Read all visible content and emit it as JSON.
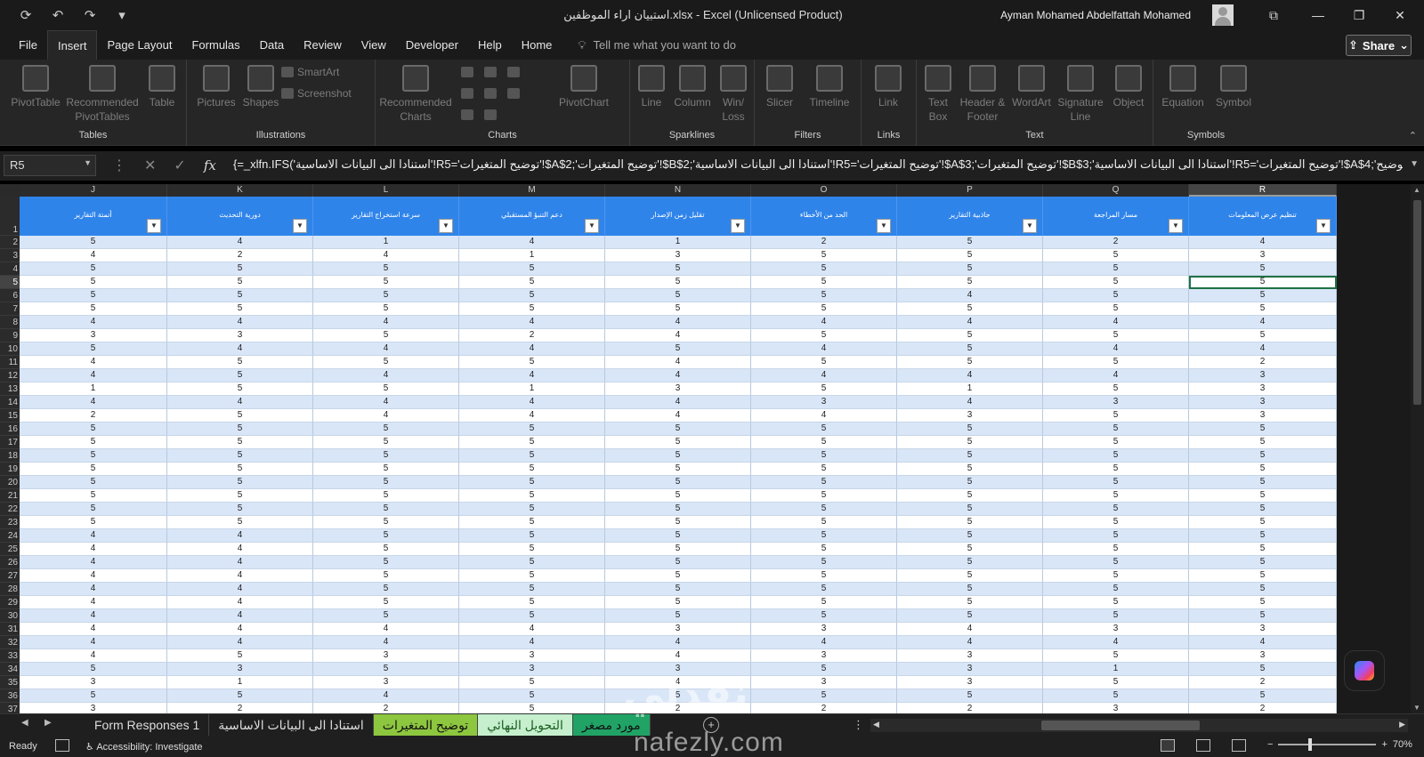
{
  "title_bar": {
    "doc_title": "استبيان اراء الموظفين.xlsx  -  Excel (Unlicensed Product)",
    "user_name": "Ayman Mohamed Abdelfattah Mohamed",
    "icons": [
      "autosave-icon",
      "undo-icon",
      "redo-icon",
      "customize-quick-access-icon",
      "ribbon-display-icon",
      "minimize-icon",
      "maximize-icon",
      "close-icon"
    ]
  },
  "menu": {
    "items": [
      "File",
      "Insert",
      "Page Layout",
      "Formulas",
      "Data",
      "Review",
      "View",
      "Developer",
      "Help",
      "Home"
    ],
    "active": "Insert",
    "tell_me": "Tell me what you want to do",
    "share": "Share"
  },
  "ribbon": {
    "groups": [
      {
        "label": "Tables",
        "buttons": [
          "PivotTable",
          "Recommended PivotTables",
          "Table"
        ]
      },
      {
        "label": "Illustrations",
        "buttons": [
          "Pictures",
          "Shapes"
        ],
        "small": [
          "SmartArt",
          "Screenshot"
        ]
      },
      {
        "label": "Charts",
        "buttons": [
          "Recommended Charts",
          "PivotChart"
        ]
      },
      {
        "label": "Sparklines",
        "buttons": [
          "Line",
          "Column",
          "Win/ Loss"
        ]
      },
      {
        "label": "Filters",
        "buttons": [
          "Slicer",
          "Timeline"
        ]
      },
      {
        "label": "Links",
        "buttons": [
          "Link"
        ]
      },
      {
        "label": "Text",
        "buttons": [
          "Text Box",
          "Header & Footer",
          "WordArt",
          "Signature Line",
          "Object"
        ]
      },
      {
        "label": "Symbols",
        "buttons": [
          "Equation",
          "Symbol"
        ]
      }
    ]
  },
  "formula_bar": {
    "name_box": "R5",
    "formula": "{=_xlfn.IFS('استنادا الى البيانات الاساسية'!R5='توضيح المتغيرات'!$A$2;'توضيح المتغيرات'!$B$2;'استنادا الى البيانات الاساسية'!R5='توضيح المتغيرات'!$A$3;'توضيح المتغيرات'!$B$3;'استنادا الى البيانات الاساسية'!R5='توضيح المتغيرات'!$A$4;'توضيح"
  },
  "sheet": {
    "columns": [
      "J",
      "K",
      "L",
      "M",
      "N",
      "O",
      "P",
      "Q",
      "R"
    ],
    "selected_column": "R",
    "headers": [
      "أتمتة التقارير",
      "دورية التحديث",
      "سرعة استخراج التقارير",
      "دعم التنبؤ المستقبلي",
      "تقليل زمن الإصدار",
      "الحد من الأخطاء",
      "جاذبية التقارير",
      "مسار المراجعة",
      "تنظيم عرض المعلومات"
    ],
    "rows": [
      {
        "n": "2",
        "v": [
          "5",
          "4",
          "1",
          "4",
          "1",
          "2",
          "5",
          "2",
          "4"
        ]
      },
      {
        "n": "3",
        "v": [
          "4",
          "2",
          "4",
          "1",
          "3",
          "5",
          "5",
          "5",
          "3"
        ]
      },
      {
        "n": "4",
        "v": [
          "5",
          "5",
          "5",
          "5",
          "5",
          "5",
          "5",
          "5",
          "5"
        ]
      },
      {
        "n": "5",
        "v": [
          "5",
          "5",
          "5",
          "5",
          "5",
          "5",
          "5",
          "5",
          "5"
        ]
      },
      {
        "n": "6",
        "v": [
          "5",
          "5",
          "5",
          "5",
          "5",
          "5",
          "4",
          "5",
          "5"
        ]
      },
      {
        "n": "7",
        "v": [
          "5",
          "5",
          "5",
          "5",
          "5",
          "5",
          "5",
          "5",
          "5"
        ]
      },
      {
        "n": "8",
        "v": [
          "4",
          "4",
          "4",
          "4",
          "4",
          "4",
          "4",
          "4",
          "4"
        ]
      },
      {
        "n": "9",
        "v": [
          "3",
          "3",
          "5",
          "2",
          "4",
          "5",
          "5",
          "5",
          "5"
        ]
      },
      {
        "n": "10",
        "v": [
          "5",
          "4",
          "4",
          "4",
          "5",
          "4",
          "5",
          "4",
          "4"
        ]
      },
      {
        "n": "11",
        "v": [
          "4",
          "5",
          "5",
          "5",
          "4",
          "5",
          "5",
          "5",
          "2"
        ]
      },
      {
        "n": "12",
        "v": [
          "4",
          "5",
          "4",
          "4",
          "4",
          "4",
          "4",
          "4",
          "3"
        ]
      },
      {
        "n": "13",
        "v": [
          "1",
          "5",
          "5",
          "1",
          "3",
          "5",
          "1",
          "5",
          "3"
        ]
      },
      {
        "n": "14",
        "v": [
          "4",
          "4",
          "4",
          "4",
          "4",
          "3",
          "4",
          "3",
          "3"
        ]
      },
      {
        "n": "15",
        "v": [
          "2",
          "5",
          "4",
          "4",
          "4",
          "4",
          "3",
          "5",
          "3"
        ]
      },
      {
        "n": "16",
        "v": [
          "5",
          "5",
          "5",
          "5",
          "5",
          "5",
          "5",
          "5",
          "5"
        ]
      },
      {
        "n": "17",
        "v": [
          "5",
          "5",
          "5",
          "5",
          "5",
          "5",
          "5",
          "5",
          "5"
        ]
      },
      {
        "n": "18",
        "v": [
          "5",
          "5",
          "5",
          "5",
          "5",
          "5",
          "5",
          "5",
          "5"
        ]
      },
      {
        "n": "19",
        "v": [
          "5",
          "5",
          "5",
          "5",
          "5",
          "5",
          "5",
          "5",
          "5"
        ]
      },
      {
        "n": "20",
        "v": [
          "5",
          "5",
          "5",
          "5",
          "5",
          "5",
          "5",
          "5",
          "5"
        ]
      },
      {
        "n": "21",
        "v": [
          "5",
          "5",
          "5",
          "5",
          "5",
          "5",
          "5",
          "5",
          "5"
        ]
      },
      {
        "n": "22",
        "v": [
          "5",
          "5",
          "5",
          "5",
          "5",
          "5",
          "5",
          "5",
          "5"
        ]
      },
      {
        "n": "23",
        "v": [
          "5",
          "5",
          "5",
          "5",
          "5",
          "5",
          "5",
          "5",
          "5"
        ]
      },
      {
        "n": "24",
        "v": [
          "4",
          "4",
          "5",
          "5",
          "5",
          "5",
          "5",
          "5",
          "5"
        ]
      },
      {
        "n": "25",
        "v": [
          "4",
          "4",
          "5",
          "5",
          "5",
          "5",
          "5",
          "5",
          "5"
        ]
      },
      {
        "n": "26",
        "v": [
          "4",
          "4",
          "5",
          "5",
          "5",
          "5",
          "5",
          "5",
          "5"
        ]
      },
      {
        "n": "27",
        "v": [
          "4",
          "4",
          "5",
          "5",
          "5",
          "5",
          "5",
          "5",
          "5"
        ]
      },
      {
        "n": "28",
        "v": [
          "4",
          "4",
          "5",
          "5",
          "5",
          "5",
          "5",
          "5",
          "5"
        ]
      },
      {
        "n": "29",
        "v": [
          "4",
          "4",
          "5",
          "5",
          "5",
          "5",
          "5",
          "5",
          "5"
        ]
      },
      {
        "n": "30",
        "v": [
          "4",
          "4",
          "5",
          "5",
          "5",
          "5",
          "5",
          "5",
          "5"
        ]
      },
      {
        "n": "31",
        "v": [
          "4",
          "4",
          "4",
          "4",
          "3",
          "3",
          "4",
          "3",
          "3"
        ]
      },
      {
        "n": "32",
        "v": [
          "4",
          "4",
          "4",
          "4",
          "4",
          "4",
          "4",
          "4",
          "4"
        ]
      },
      {
        "n": "33",
        "v": [
          "4",
          "5",
          "3",
          "3",
          "4",
          "3",
          "3",
          "5",
          "3"
        ]
      },
      {
        "n": "34",
        "v": [
          "5",
          "3",
          "5",
          "3",
          "3",
          "5",
          "3",
          "1",
          "5"
        ]
      },
      {
        "n": "35",
        "v": [
          "3",
          "1",
          "3",
          "5",
          "4",
          "3",
          "3",
          "5",
          "2"
        ]
      },
      {
        "n": "36",
        "v": [
          "5",
          "5",
          "4",
          "5",
          "5",
          "5",
          "5",
          "5",
          "5"
        ]
      },
      {
        "n": "37",
        "v": [
          "3",
          "2",
          "2",
          "5",
          "2",
          "2",
          "2",
          "3",
          "2"
        ]
      }
    ],
    "selected_cell": {
      "row": "5",
      "col": "R"
    }
  },
  "sheet_tabs": {
    "tabs": [
      {
        "label": "Form Responses 1",
        "color": "#1f1f1f",
        "text": "#dddddd"
      },
      {
        "label": "استنادا الى البيانات الاساسية",
        "color": "#1f1f1f",
        "text": "#dddddd"
      },
      {
        "label": "توضيح المتغيرات",
        "color": "#8dc63f",
        "text": "#111111"
      },
      {
        "label": "التحويل النهائي",
        "color": "#c6efce",
        "text": "#1b5e20"
      },
      {
        "label": "مورد مصغر",
        "color": "#21a366",
        "text": "#111111"
      }
    ]
  },
  "status_bar": {
    "ready": "Ready",
    "accessibility": "Accessibility: Investigate",
    "zoom": "70%"
  },
  "watermark": {
    "arabic": "نفذلي",
    "latin": "nafezly.com"
  }
}
